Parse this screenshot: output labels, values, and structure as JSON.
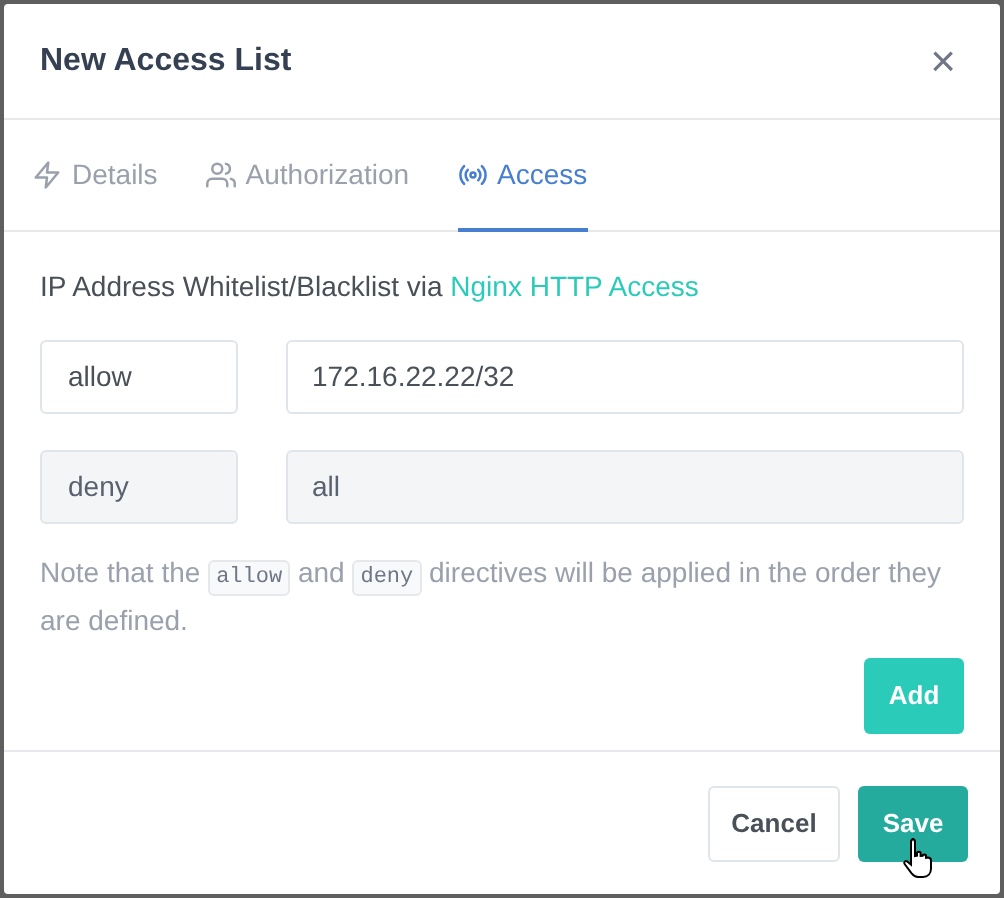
{
  "dialog": {
    "title": "New Access List",
    "close": "×"
  },
  "tabs": [
    {
      "label": "Details",
      "kind": "bolt",
      "selected": false
    },
    {
      "label": "Authorization",
      "kind": "users",
      "selected": false
    },
    {
      "label": "Access",
      "kind": "broadcast",
      "selected": true
    }
  ],
  "intro": {
    "text": "IP Address Whitelist/Blacklist via",
    "link": "Nginx HTTP Access"
  },
  "rules": [
    {
      "directive": "allow",
      "address": "172.16.22.22/32",
      "disabled": false
    },
    {
      "directive": "deny",
      "address": "all",
      "disabled": true
    }
  ],
  "note": [
    {
      "kind": "text",
      "text": "Note that the"
    },
    {
      "kind": "code",
      "text": "allow"
    },
    {
      "kind": "text",
      "text": "and"
    },
    {
      "kind": "code",
      "text": "deny"
    },
    {
      "kind": "text",
      "text": "directives will be applied in the order they are defined."
    }
  ],
  "add_button": "Add",
  "footer": {
    "cancel": "Cancel",
    "save": "Save",
    "save_hovered": true
  }
}
